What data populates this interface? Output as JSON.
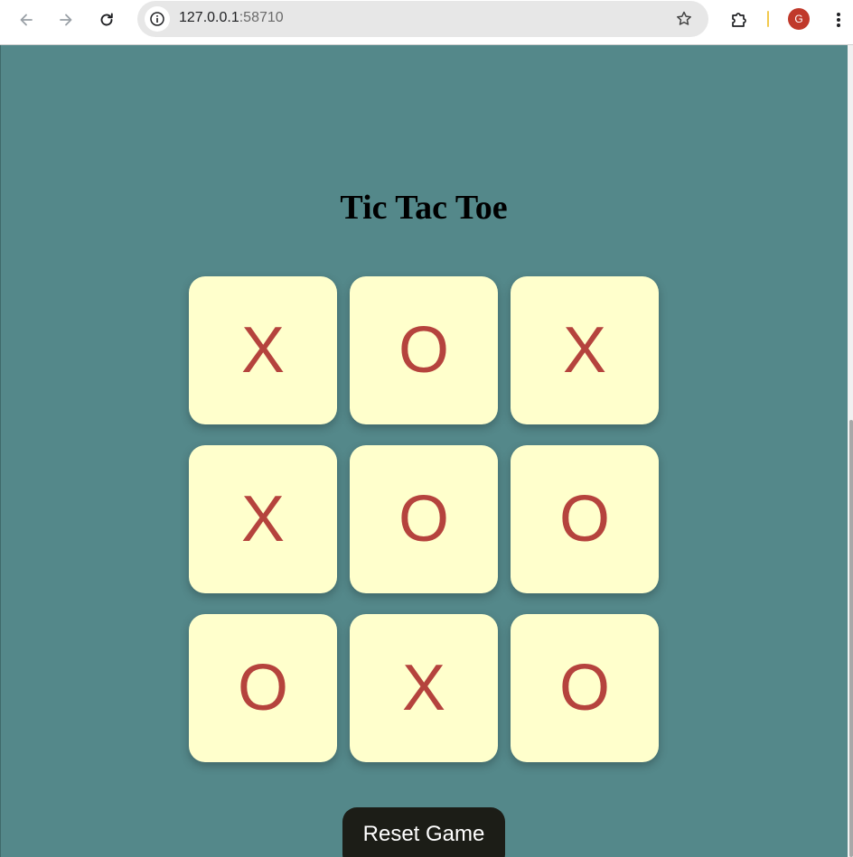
{
  "browser": {
    "url_host": "127.0.0.1",
    "url_port": ":58710",
    "profile_initial": "G"
  },
  "game": {
    "title": "Tic Tac Toe",
    "board": [
      "X",
      "O",
      "X",
      "X",
      "O",
      "O",
      "O",
      "X",
      "O"
    ],
    "reset_label": "Reset Game"
  },
  "icons": {
    "back": "back-arrow-icon",
    "forward": "forward-arrow-icon",
    "reload": "reload-icon",
    "site_info": "info-icon",
    "bookmark": "star-icon",
    "extensions": "puzzle-icon",
    "menu": "kebab-menu-icon"
  },
  "colors": {
    "page_background": "#54888a",
    "cell_background": "#ffffcc",
    "mark_color": "#b5433d",
    "button_background": "#1c1d17",
    "avatar_background": "#c0392b"
  }
}
